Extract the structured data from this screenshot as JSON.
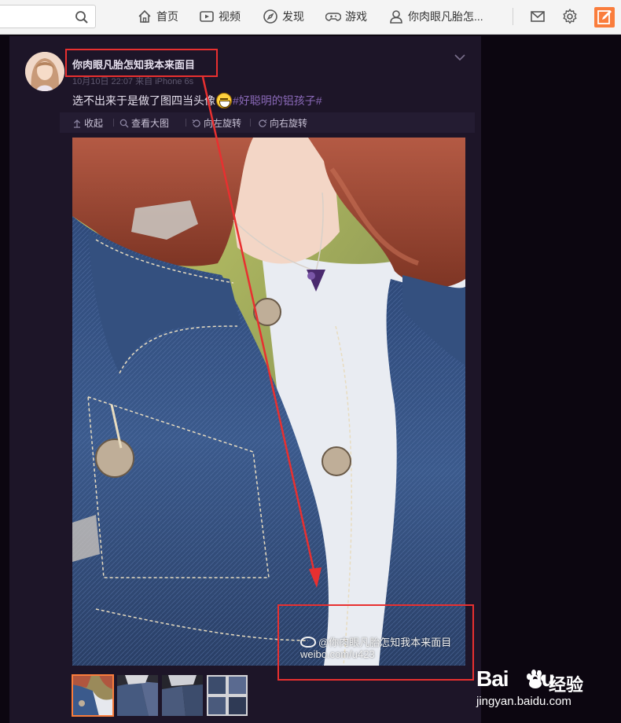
{
  "search": {
    "placeholder": ""
  },
  "nav": {
    "items": [
      {
        "label": "首页",
        "icon": "home-icon"
      },
      {
        "label": "视频",
        "icon": "video-icon"
      },
      {
        "label": "发现",
        "icon": "compass-icon"
      },
      {
        "label": "游戏",
        "icon": "gamepad-icon"
      },
      {
        "label": "你肉眼凡胎怎...",
        "icon": "user-icon"
      }
    ],
    "right_icons": [
      "mail-icon",
      "gear-icon",
      "compose-icon"
    ],
    "accent": "#fa7d3c"
  },
  "post": {
    "username": "你肉眼凡胎怎知我本来面目",
    "time": "10月10日 22:07",
    "source_prefix": "来自",
    "source": "iPhone 6s",
    "text_before": "选不出来于是做了图四当头像",
    "emoji": "laughing-emoji-icon",
    "hashtag": "#好聪明的铝孩子#",
    "toolbar": {
      "collapse": "收起",
      "view_large": "查看大图",
      "rotate_left": "向左旋转",
      "rotate_right": "向右旋转"
    },
    "image_watermark": {
      "handle": "@你肉眼凡胎怎知我本来面目",
      "url": "weibo.com/u423"
    },
    "thumbnail_count": 4,
    "selected_thumbnail": 1
  },
  "colors": {
    "card_bg": "#1d1528",
    "page_bg": "#0c0610",
    "hashtag": "#8a69b8",
    "annotation": "#e83030"
  },
  "watermark": {
    "brand": "Bai",
    "brand2": "经验",
    "brand_suffix": "du",
    "url": "jingyan.baidu.com"
  }
}
